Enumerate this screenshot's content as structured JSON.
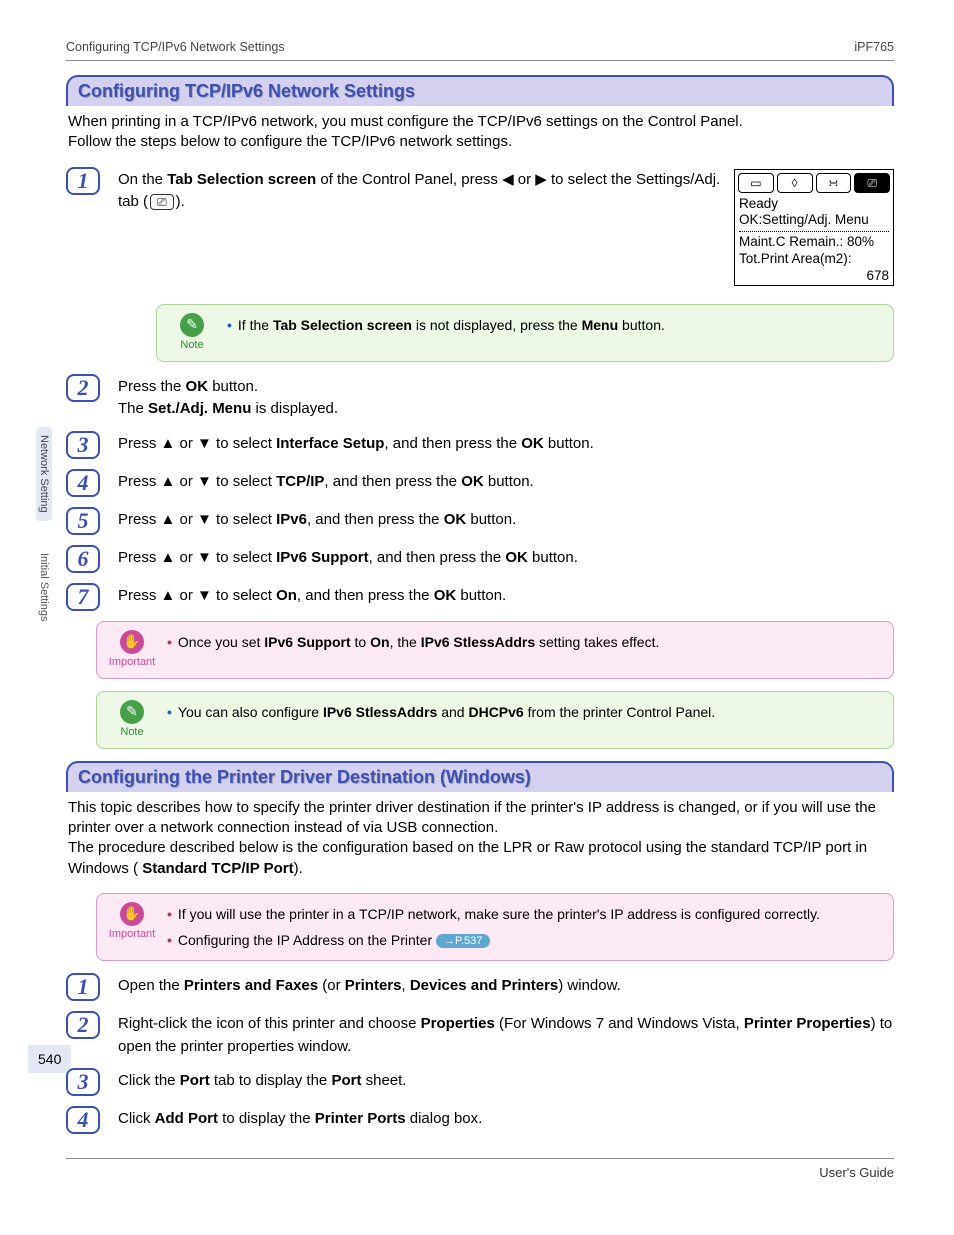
{
  "header": {
    "left": "Configuring TCP/IPv6 Network Settings",
    "right": "iPF765"
  },
  "sidebar": {
    "tab1": "Network Setting",
    "tab2": "Initial Settings"
  },
  "page_number": "540",
  "footer": {
    "right": "User's Guide"
  },
  "sectionA": {
    "title": "Configuring TCP/IPv6 Network Settings",
    "intro1": "When printing in a TCP/IPv6 network, you must configure the TCP/IPv6 settings on the Control Panel.",
    "intro2": "Follow the steps below to configure the TCP/IPv6 network settings.",
    "step1_a": "On the ",
    "step1_b": "Tab Selection screen",
    "step1_c": " of the Control Panel, press ◀ or ▶ to select the Settings/Adj. tab (",
    "step1_d": ").",
    "lcd": {
      "ready": "Ready",
      "ok": "OK:Setting/Adj. Menu",
      "maint": "Maint.C Remain.: 80%",
      "tot": "Tot.Print Area(m2):",
      "val": "678"
    },
    "note1_a": "If the ",
    "note1_b": "Tab Selection screen",
    "note1_c": " is not displayed, press the ",
    "note1_d": "Menu",
    "note1_e": " button.",
    "step2_a": "Press the ",
    "step2_b": "OK",
    "step2_c": " button.",
    "step2_d": "The ",
    "step2_e": "Set./Adj. Menu",
    "step2_f": " is displayed.",
    "step3_a": "Press ▲ or ▼ to select ",
    "step3_b": "Interface Setup",
    "step3_c": ", and then press the ",
    "step3_d": "OK",
    "step3_e": " button.",
    "step4_a": "Press ▲ or ▼ to select ",
    "step4_b": "TCP/IP",
    "step4_c": ", and then press the ",
    "step4_d": "OK",
    "step4_e": " button.",
    "step5_a": "Press ▲ or ▼ to select ",
    "step5_b": "IPv6",
    "step5_c": ", and then press the ",
    "step5_d": "OK",
    "step5_e": " button.",
    "step6_a": "Press ▲ or ▼ to select ",
    "step6_b": "IPv6 Support",
    "step6_c": ", and then press the ",
    "step6_d": "OK",
    "step6_e": " button.",
    "step7_a": "Press ▲ or ▼ to select ",
    "step7_b": "On",
    "step7_c": ", and then press the ",
    "step7_d": "OK",
    "step7_e": " button.",
    "imp1_a": "Once you set ",
    "imp1_b": "IPv6 Support",
    "imp1_c": " to ",
    "imp1_d": "On",
    "imp1_e": ", the ",
    "imp1_f": "IPv6 StlessAddrs",
    "imp1_g": " setting takes effect.",
    "note2_a": "You can also configure ",
    "note2_b": "IPv6 StlessAddrs",
    "note2_c": " and ",
    "note2_d": "DHCPv6",
    "note2_e": " from the printer Control Panel."
  },
  "sectionB": {
    "title": "Configuring the Printer Driver Destination (Windows)",
    "p1": "This topic describes how to specify the printer driver destination if the printer's IP address is changed, or if you will use the printer over a network connection instead of via USB connection.",
    "p2_a": "The procedure described below is the configuration based on the LPR or Raw protocol using the standard TCP/IP port in Windows ( ",
    "p2_b": "Standard TCP/IP Port",
    "p2_c": ").",
    "imp_line1": "If you will use the printer in a TCP/IP network, make sure the printer's IP address is configured correctly.",
    "imp_line2": "Configuring the IP Address on the Printer",
    "imp_xref": "→P.537",
    "step1_a": "Open the ",
    "step1_b": "Printers and Faxes",
    "step1_c": " (or ",
    "step1_d": "Printers",
    "step1_e": ", ",
    "step1_f": "Devices and Printers",
    "step1_g": ") window.",
    "step2_a": "Right-click the icon of this printer and choose ",
    "step2_b": "Properties",
    "step2_c": " (For Windows 7 and Windows Vista, ",
    "step2_d": "Printer Properties",
    "step2_e": ") to open the printer properties window.",
    "step3_a": "Click the ",
    "step3_b": "Port",
    "step3_c": " tab to display the ",
    "step3_d": "Port",
    "step3_e": " sheet.",
    "step4_a": "Click ",
    "step4_b": "Add Port",
    "step4_c": " to display the ",
    "step4_d": "Printer Ports",
    "step4_e": " dialog box."
  },
  "labels": {
    "note": "Note",
    "important": "Important"
  }
}
